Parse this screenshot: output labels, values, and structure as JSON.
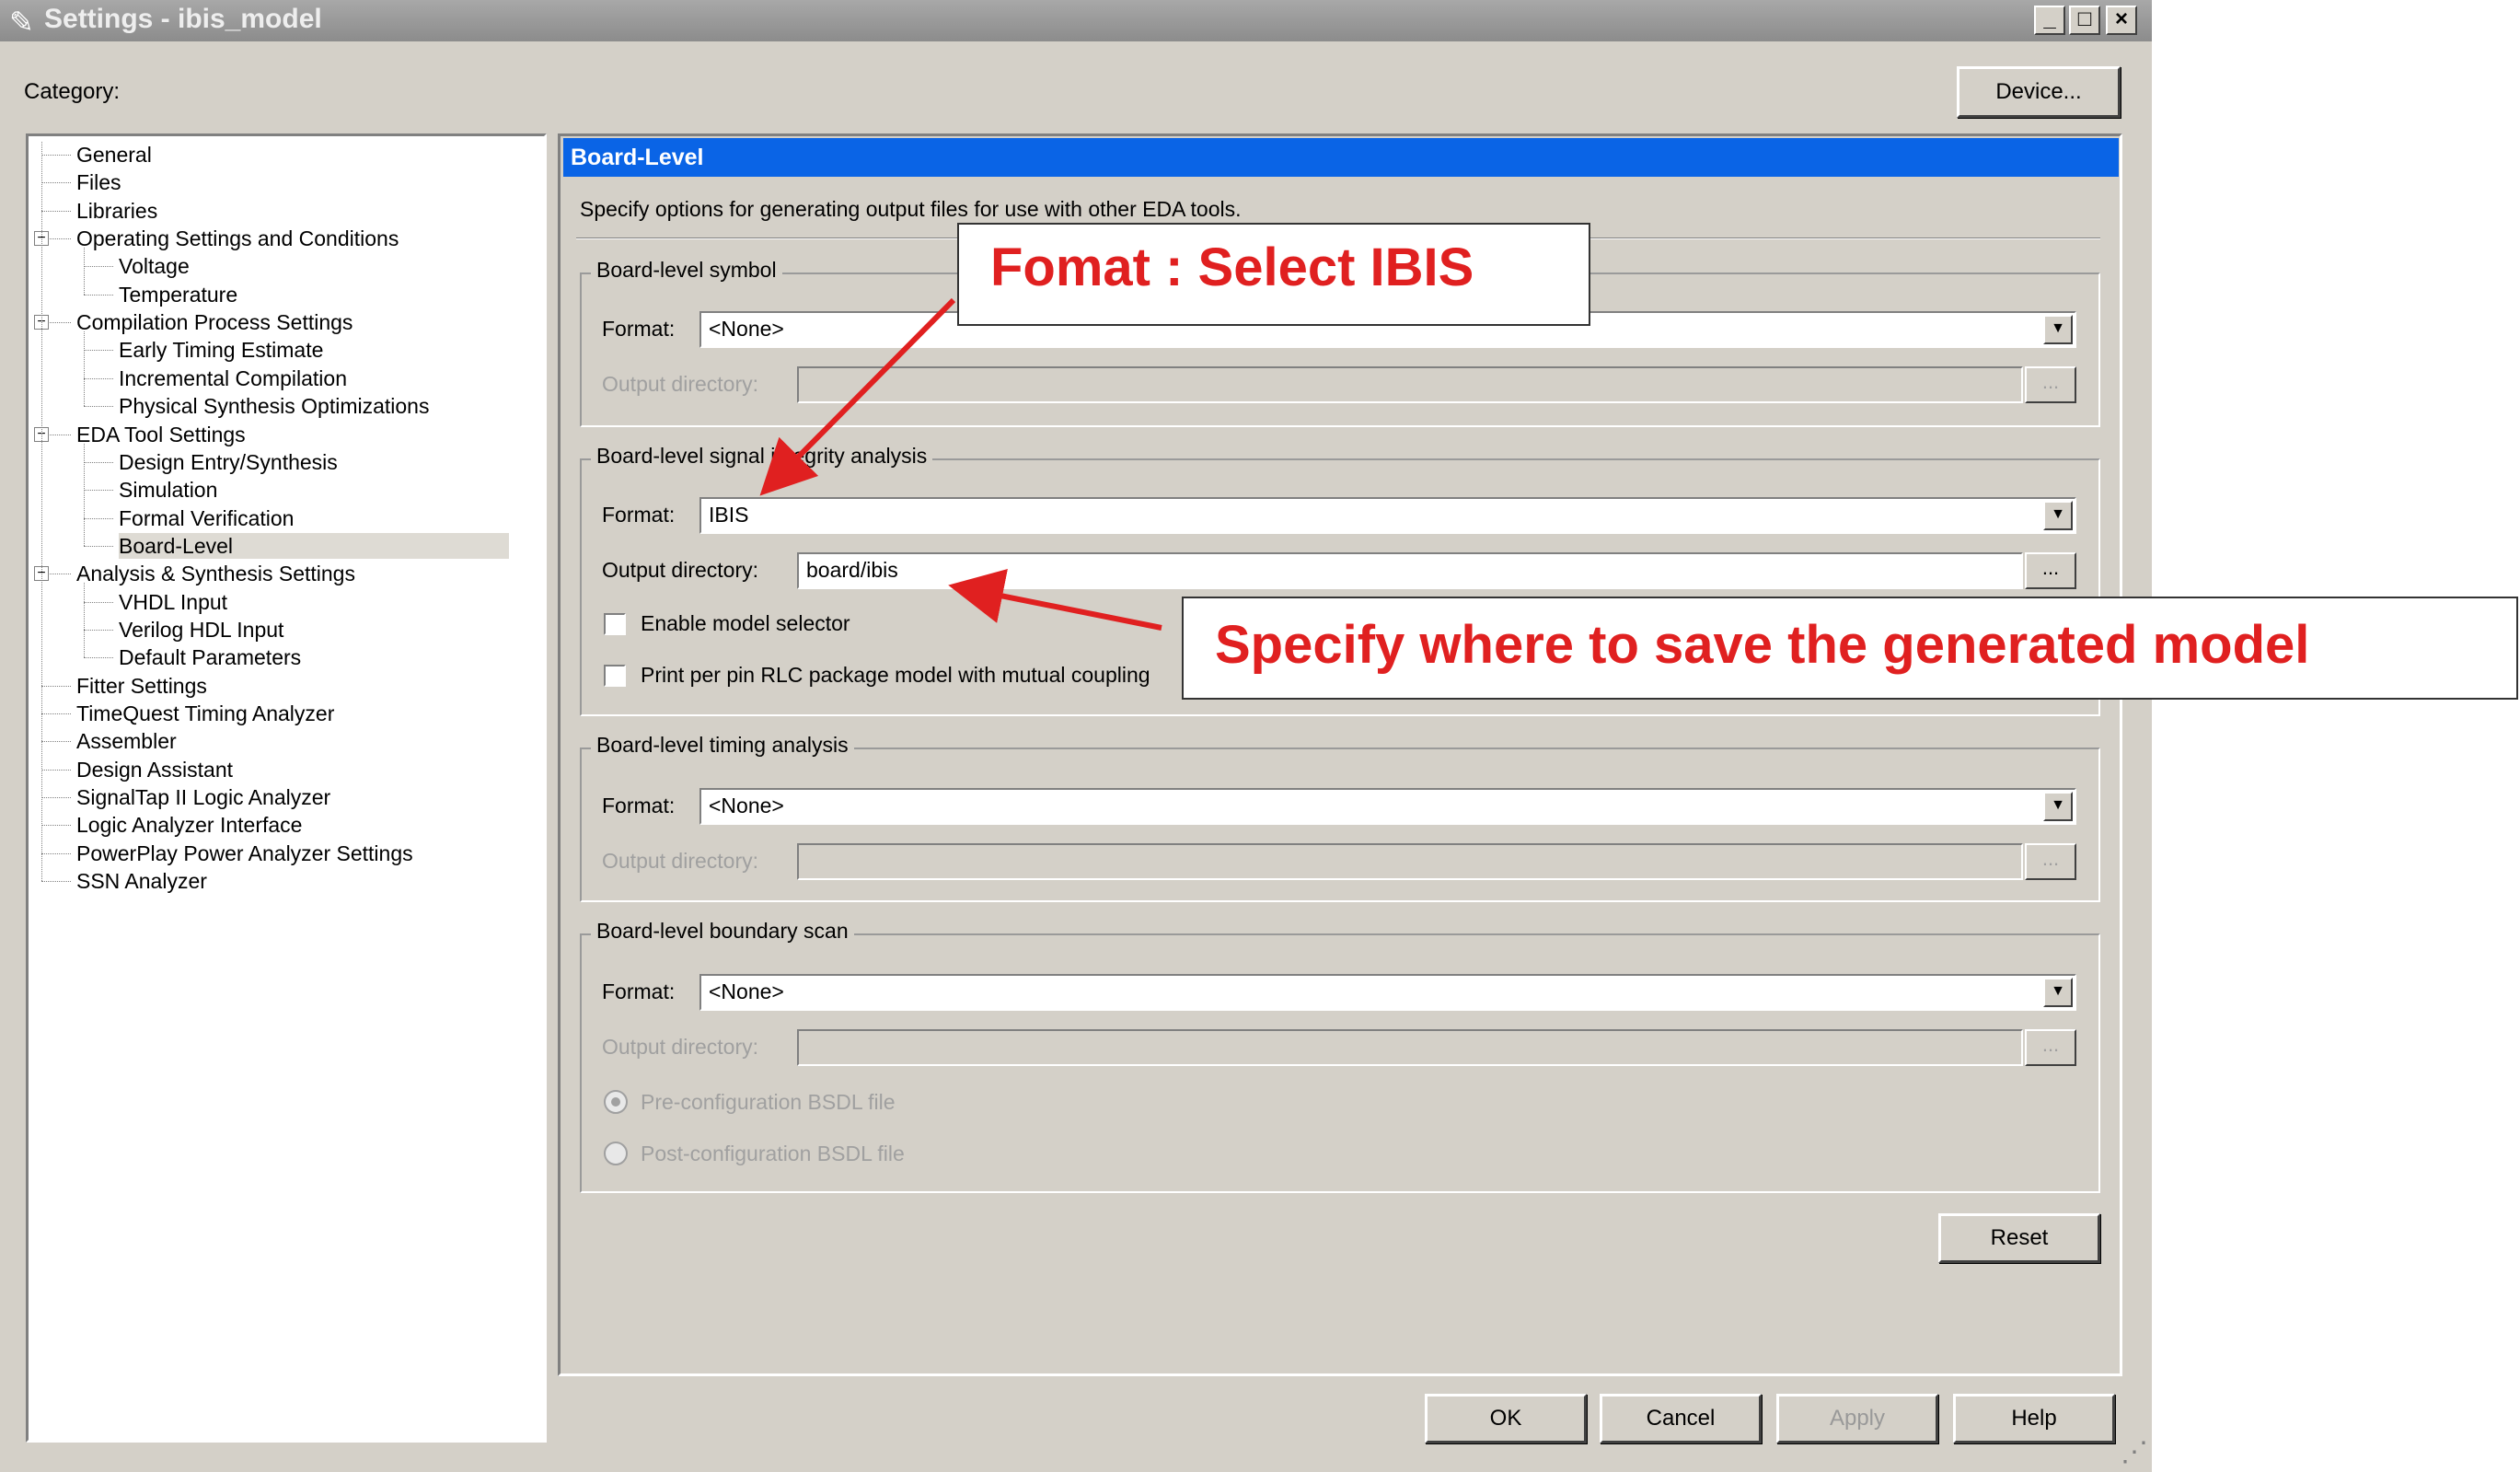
{
  "window": {
    "title": "Settings - ibis_model",
    "pencil_icon": "✎",
    "min_icon": "_",
    "max_icon": "□",
    "close_icon": "×"
  },
  "category_label": "Category:",
  "device_button": "Device...",
  "tree": [
    {
      "label": "General",
      "level": 1
    },
    {
      "label": "Files",
      "level": 1
    },
    {
      "label": "Libraries",
      "level": 1
    },
    {
      "label": "Operating Settings and Conditions",
      "level": 1,
      "expander": "−"
    },
    {
      "label": "Voltage",
      "level": 2
    },
    {
      "label": "Temperature",
      "level": 2
    },
    {
      "label": "Compilation Process Settings",
      "level": 1,
      "expander": "−"
    },
    {
      "label": "Early Timing Estimate",
      "level": 2
    },
    {
      "label": "Incremental Compilation",
      "level": 2
    },
    {
      "label": "Physical Synthesis Optimizations",
      "level": 2
    },
    {
      "label": "EDA Tool Settings",
      "level": 1,
      "expander": "−"
    },
    {
      "label": "Design Entry/Synthesis",
      "level": 2
    },
    {
      "label": "Simulation",
      "level": 2
    },
    {
      "label": "Formal Verification",
      "level": 2
    },
    {
      "label": "Board-Level",
      "level": 2,
      "selected": true
    },
    {
      "label": "Analysis & Synthesis Settings",
      "level": 1,
      "expander": "−"
    },
    {
      "label": "VHDL Input",
      "level": 2
    },
    {
      "label": "Verilog HDL Input",
      "level": 2
    },
    {
      "label": "Default Parameters",
      "level": 2
    },
    {
      "label": "Fitter Settings",
      "level": 1
    },
    {
      "label": "TimeQuest Timing Analyzer",
      "level": 1
    },
    {
      "label": "Assembler",
      "level": 1
    },
    {
      "label": "Design Assistant",
      "level": 1
    },
    {
      "label": "SignalTap II Logic Analyzer",
      "level": 1
    },
    {
      "label": "Logic Analyzer Interface",
      "level": 1
    },
    {
      "label": "PowerPlay Power Analyzer Settings",
      "level": 1
    },
    {
      "label": "SSN Analyzer",
      "level": 1
    }
  ],
  "panel": {
    "header": "Board-Level",
    "description": "Specify options for generating output files for use with other EDA tools.",
    "format_label": "Format:",
    "output_dir_label": "Output directory:",
    "browse_label": "...",
    "dropdown_arrow": "▼",
    "groups": {
      "symbol": {
        "title": "Board-level symbol",
        "format": "<None>",
        "output_dir": ""
      },
      "signal": {
        "title": "Board-level signal integrity analysis",
        "format": "IBIS",
        "output_dir": "board/ibis",
        "enable_model_selector": "Enable model selector",
        "print_rlc": "Print per pin RLC package model with mutual coupling"
      },
      "timing": {
        "title": "Board-level timing analysis",
        "format": "<None>",
        "output_dir": ""
      },
      "boundary": {
        "title": "Board-level boundary scan",
        "format": "<None>",
        "output_dir": "",
        "pre_config": "Pre-configuration BSDL file",
        "post_config": "Post-configuration BSDL file"
      }
    },
    "reset_button": "Reset"
  },
  "footer": {
    "ok": "OK",
    "cancel": "Cancel",
    "apply": "Apply",
    "help": "Help"
  },
  "annotations": {
    "format_callout": "Fomat : Select IBIS",
    "output_callout": "Specify where to save the generated model",
    "arrow_color": "#e02020"
  }
}
